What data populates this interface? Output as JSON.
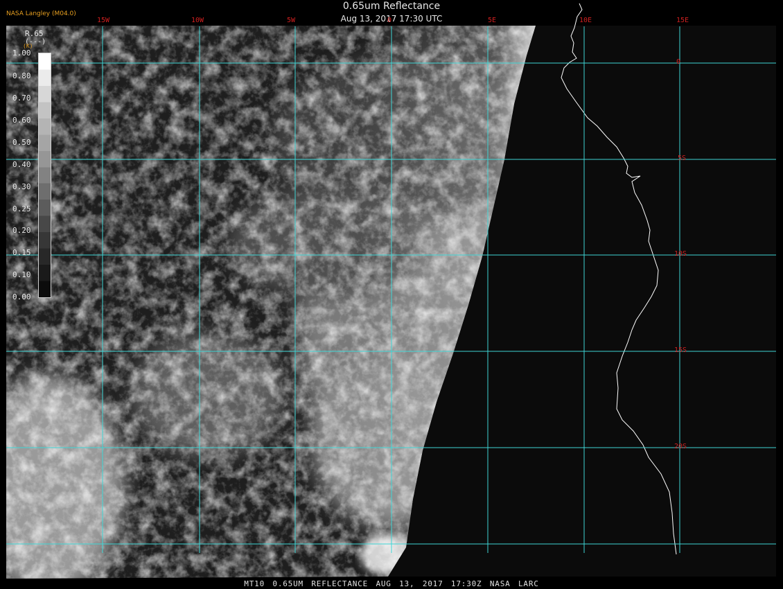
{
  "header": {
    "title": "0.65um Reflectance",
    "subtitle": "Aug 13, 2017 17:30 UTC",
    "org": "NASA Langley (M04.0)"
  },
  "footer": {
    "text": "MT10  0.65UM REFLECTANCE  AUG 13, 2017 17:30Z  NASA LARC"
  },
  "legend": {
    "name": "R.65",
    "unit": "(---)",
    "unit2": "(K)",
    "ticks": [
      "1.00",
      "0.80",
      "0.70",
      "0.60",
      "0.50",
      "0.40",
      "0.30",
      "0.25",
      "0.20",
      "0.15",
      "0.10",
      "0.00"
    ],
    "gray_levels": [
      255,
      235,
      215,
      195,
      180,
      165,
      150,
      130,
      110,
      92,
      72,
      55,
      40,
      26,
      12
    ]
  },
  "map": {
    "longitude_labels": [
      "15W",
      "10W",
      "5W",
      "0",
      "5E",
      "10E",
      "15E"
    ],
    "latitude_labels": [
      "0",
      "5S",
      "10S",
      "15S",
      "20S"
    ]
  },
  "colors": {
    "grid": "#3fd6d6",
    "grid_labels": "#d02020",
    "coastline": "#ffffff",
    "background": "#000000",
    "org_text": "#e8a020"
  }
}
